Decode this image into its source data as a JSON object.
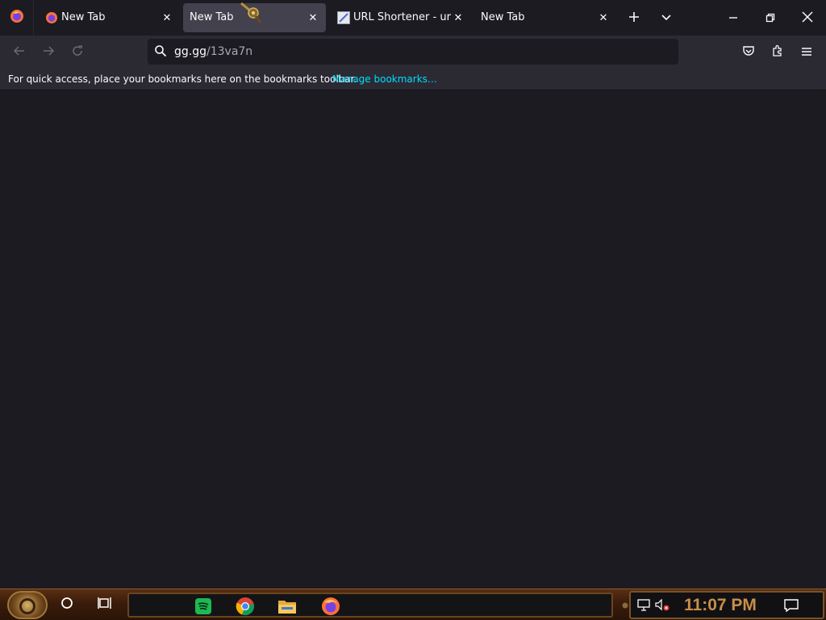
{
  "browser": {
    "tabs": [
      {
        "title": "New Tab",
        "active": false,
        "favicon": "firefox-icon"
      },
      {
        "title": "New Tab",
        "active": true,
        "favicon": "none"
      },
      {
        "title": "URL Shortener - url sh",
        "active": false,
        "favicon": "url-shortener-icon"
      },
      {
        "title": "New Tab",
        "active": false,
        "favicon": "none"
      }
    ],
    "close_glyph": "✕",
    "urlbar": {
      "host": "gg.gg",
      "path": "/13va7n"
    },
    "bookmarks_bar": {
      "message": "For quick access, place your bookmarks here on the bookmarks toolbar.",
      "link": "Manage bookmarks…"
    }
  },
  "taskbar": {
    "pinned": [
      "spotify-icon",
      "chrome-icon",
      "file-explorer-icon",
      "firefox-icon"
    ],
    "clock": "11:07 PM",
    "volume_muted": true
  },
  "colors": {
    "accent_link": "#00ddff",
    "chrome_bg": "#1c1b22",
    "toolbar_bg": "#2b2a33",
    "clock": "#c98e48"
  }
}
